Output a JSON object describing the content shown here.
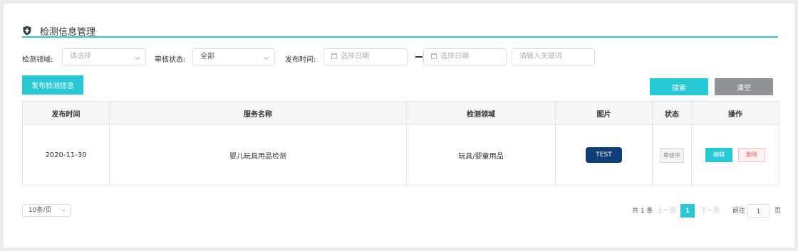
{
  "header": {
    "title": "检测信息管理",
    "icon": "shield-icon"
  },
  "filters": {
    "field_label": "检测领域:",
    "field_placeholder": "请选择",
    "status_label": "审核状态:",
    "status_value": "全部",
    "date_label": "发布时间:",
    "date_start_placeholder": "选择日期",
    "date_end_placeholder": "选择日期",
    "keyword_placeholder": "请输入关键词"
  },
  "actions": {
    "publish": "发布检测信息",
    "search": "搜索",
    "clear": "清空"
  },
  "table": {
    "headers": [
      "发布时间",
      "服务名称",
      "检测领域",
      "图片",
      "状态",
      "操作"
    ],
    "rows": [
      {
        "date": "2020-11-30",
        "service": "婴儿玩具用品检测",
        "field": "玩具/婴童用品",
        "image_label": "TEST",
        "status": "审核中",
        "edit": "编辑",
        "delete": "删除"
      }
    ]
  },
  "pagination": {
    "page_size": "10条/页",
    "total": "共 1 条",
    "prev": "上一页",
    "current": "1",
    "next": "下一页",
    "goto": "前往",
    "goto_value": "1",
    "unit": "页"
  },
  "colors": {
    "accent": "#27c9d5",
    "clear_button": "#8f9297",
    "image_bg": "#0e3d78",
    "delete_text": "#f25c5c"
  }
}
